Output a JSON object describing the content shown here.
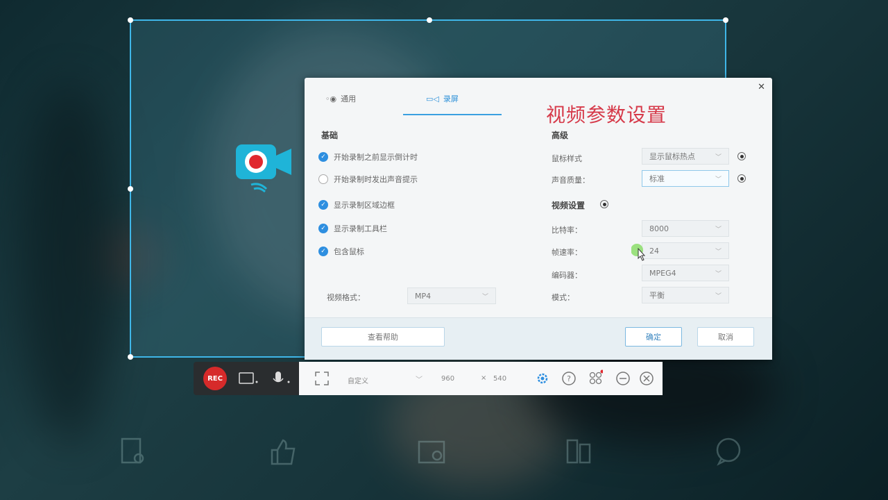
{
  "annotation": "视频参数设置",
  "dialog": {
    "close_icon": "close-icon",
    "tabs": [
      {
        "label": "通用",
        "icon": "general-icon"
      },
      {
        "label": "录屏",
        "icon": "video-camera-icon"
      }
    ],
    "basic": {
      "title": "基础",
      "options": [
        {
          "label": "开始录制之前显示倒计时",
          "checked": true
        },
        {
          "label": "开始录制时发出声音提示",
          "checked": false
        },
        {
          "label": "显示录制区域边框",
          "checked": true
        },
        {
          "label": "显示录制工具栏",
          "checked": true
        },
        {
          "label": "包含鼠标",
          "checked": true
        }
      ],
      "format_label": "视频格式：",
      "format_value": "MP4"
    },
    "advanced": {
      "title": "高级",
      "cursor_label": "鼠标样式",
      "cursor_value": "显示鼠标热点",
      "volume_label": "声音质量：",
      "volume_value": "标准"
    },
    "video": {
      "title": "视频设置",
      "bitrate_label": "比特率：",
      "bitrate_value": "8000",
      "framerate_label": "帧速率：",
      "framerate_value": "24",
      "encoder_label": "编码器：",
      "encoder_value": "MPEG4",
      "mode_label": "模式：",
      "mode_value": "平衡"
    },
    "footer": {
      "reset_label": "查看帮助",
      "ok_label": "确定",
      "cancel_label": "取消"
    }
  },
  "toolbar": {
    "rec_label": "REC",
    "region_value": "自定义",
    "width_value": "960",
    "times_sign": "×",
    "height_value": "540"
  },
  "colors": {
    "accent": "#2e8fe0",
    "rec": "#d62a2a",
    "annotation": "#d63a4a",
    "capture_border": "#3fb6e8"
  }
}
